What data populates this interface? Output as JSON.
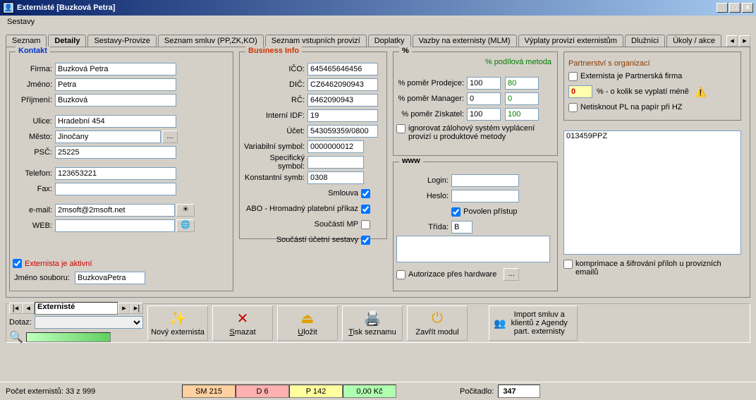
{
  "window": {
    "title": "Externisté [Buzková Petra]"
  },
  "menu": {
    "sestavy": "Sestavy"
  },
  "tabs": {
    "t0": "Seznam",
    "t1": "Detaily",
    "t2": "Sestavy-Provize",
    "t3": "Seznam smluv (PP,ZK,KO)",
    "t4": "Seznam vstupních provizí",
    "t5": "Doplatky",
    "t6": "Vazby na externisty (MLM)",
    "t7": "Výplaty provizí externistům",
    "t8": "Dlužníci",
    "t9": "Úkoly / akce"
  },
  "kontakt": {
    "legend": "Kontakt",
    "firma_l": "Firma:",
    "firma_v": "Buzková Petra",
    "jmeno_l": "Jméno:",
    "jmeno_v": "Petra",
    "prijmeni_l": "Příjmení:",
    "prijmeni_v": "Buzková",
    "ulice_l": "Ulice:",
    "ulice_v": "Hradební 454",
    "mesto_l": "Město:",
    "mesto_v": "Jinočany",
    "psc_l": "PSČ:",
    "psc_v": "25225",
    "telefon_l": "Telefon:",
    "telefon_v": "123653221",
    "fax_l": "Fax:",
    "fax_v": "",
    "email_l": "e-mail:",
    "email_v": "2msoft@2msoft.net",
    "web_l": "WEB:",
    "web_v": "",
    "aktivni": "Externista je aktivní",
    "jmsoub_l": "Jméno souboru:",
    "jmsoub_v": "BuzkovaPetra"
  },
  "biz": {
    "legend": "Business Info",
    "ico_l": "IČO:",
    "ico_v": "645465646456",
    "dic_l": "DIČ:",
    "dic_v": "CZ6462090943",
    "rc_l": "RČ:",
    "rc_v": "6462090943",
    "idf_l": "Interní IDF:",
    "idf_v": "19",
    "ucet_l": "Účet:",
    "ucet_v": "543059359/0800",
    "vs_l": "Variabilní symbol:",
    "vs_v": "0000000012",
    "ss_l": "Specifický symbol:",
    "ss_v": "",
    "ks_l": "Konstantní symb:",
    "ks_v": "0308",
    "smlouva_l": "Smlouva",
    "abo_l": "ABO - Hromadný platební příkaz",
    "soucmp_l": "Součástí MP",
    "souc_l": "Součástí účetní sestavy"
  },
  "pct": {
    "legend": "%",
    "metoda": "% podílová metoda",
    "prod_l": "% poměr Prodejce:",
    "prod_v1": "100",
    "prod_v2": "80",
    "man_l": "% poměr Manager:",
    "man_v1": "0",
    "man_v2": "0",
    "zis_l": "% poměr Získatel:",
    "zis_v1": "100",
    "zis_v2": "100",
    "ignor": "ignorovat zálohový systém vyplácení provizí u produktové metody"
  },
  "www": {
    "legend": "www",
    "login_l": "Login:",
    "login_v": "",
    "heslo_l": "Heslo:",
    "heslo_v": "",
    "povolen": "Povolen přístup",
    "trida_l": "Třída:",
    "trida_v": "B",
    "autoriz": "Autorizace přes hardware",
    "dots": "..."
  },
  "partner": {
    "legend": "Partnerství s organizací",
    "partfirma": "Externista je Partnerská firma",
    "pct_v": "0",
    "pct_l": "% - o kolik se vyplatí méně",
    "netisk": "Netisknout PL na papír při HZ",
    "list_item": "013459PPZ",
    "komprim": "komprimace a šifrování příloh u provizních emailů"
  },
  "nav": {
    "name": "Externisté",
    "dotaz_l": "Dotaz:"
  },
  "buttons": {
    "novy": "Nový externista",
    "smazat": "Smazat",
    "ulozit": "Uložit",
    "tisk": "Tisk seznamu",
    "zavrit": "Zavřít modul",
    "import": "Import smluv a klientů z Agendy part. externisty"
  },
  "status": {
    "pocet": "Počet externistů: 33 z 999",
    "sm": "SM 215",
    "d": "D 6",
    "p": "P 142",
    "kc": "0,00 Kč",
    "pocitadlo_l": "Počitadlo:",
    "pocitadlo_v": "347"
  }
}
